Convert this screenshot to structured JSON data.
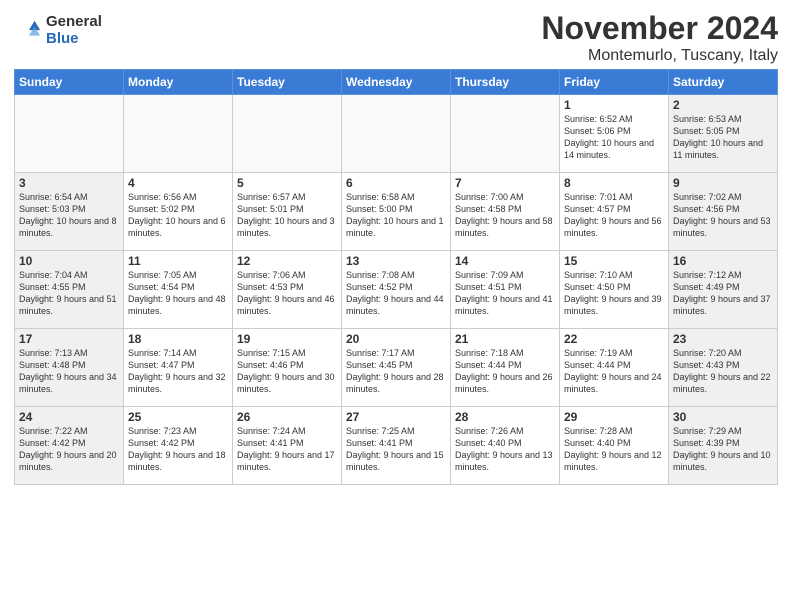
{
  "header": {
    "logo_general": "General",
    "logo_blue": "Blue",
    "month_title": "November 2024",
    "location": "Montemurlo, Tuscany, Italy"
  },
  "columns": [
    "Sunday",
    "Monday",
    "Tuesday",
    "Wednesday",
    "Thursday",
    "Friday",
    "Saturday"
  ],
  "weeks": [
    [
      {
        "day": "",
        "type": "empty",
        "info": ""
      },
      {
        "day": "",
        "type": "empty",
        "info": ""
      },
      {
        "day": "",
        "type": "empty",
        "info": ""
      },
      {
        "day": "",
        "type": "empty",
        "info": ""
      },
      {
        "day": "",
        "type": "empty",
        "info": ""
      },
      {
        "day": "1",
        "type": "weekend",
        "info": "Sunrise: 6:52 AM\nSunset: 5:06 PM\nDaylight: 10 hours and 14 minutes."
      },
      {
        "day": "2",
        "type": "weekend",
        "info": "Sunrise: 6:53 AM\nSunset: 5:05 PM\nDaylight: 10 hours and 11 minutes."
      }
    ],
    [
      {
        "day": "3",
        "type": "weekend",
        "info": "Sunrise: 6:54 AM\nSunset: 5:03 PM\nDaylight: 10 hours and 8 minutes."
      },
      {
        "day": "4",
        "type": "weekday",
        "info": "Sunrise: 6:56 AM\nSunset: 5:02 PM\nDaylight: 10 hours and 6 minutes."
      },
      {
        "day": "5",
        "type": "weekday",
        "info": "Sunrise: 6:57 AM\nSunset: 5:01 PM\nDaylight: 10 hours and 3 minutes."
      },
      {
        "day": "6",
        "type": "weekday",
        "info": "Sunrise: 6:58 AM\nSunset: 5:00 PM\nDaylight: 10 hours and 1 minute."
      },
      {
        "day": "7",
        "type": "weekday",
        "info": "Sunrise: 7:00 AM\nSunset: 4:58 PM\nDaylight: 9 hours and 58 minutes."
      },
      {
        "day": "8",
        "type": "weekend",
        "info": "Sunrise: 7:01 AM\nSunset: 4:57 PM\nDaylight: 9 hours and 56 minutes."
      },
      {
        "day": "9",
        "type": "weekend",
        "info": "Sunrise: 7:02 AM\nSunset: 4:56 PM\nDaylight: 9 hours and 53 minutes."
      }
    ],
    [
      {
        "day": "10",
        "type": "weekend",
        "info": "Sunrise: 7:04 AM\nSunset: 4:55 PM\nDaylight: 9 hours and 51 minutes."
      },
      {
        "day": "11",
        "type": "weekday",
        "info": "Sunrise: 7:05 AM\nSunset: 4:54 PM\nDaylight: 9 hours and 48 minutes."
      },
      {
        "day": "12",
        "type": "weekday",
        "info": "Sunrise: 7:06 AM\nSunset: 4:53 PM\nDaylight: 9 hours and 46 minutes."
      },
      {
        "day": "13",
        "type": "weekday",
        "info": "Sunrise: 7:08 AM\nSunset: 4:52 PM\nDaylight: 9 hours and 44 minutes."
      },
      {
        "day": "14",
        "type": "weekday",
        "info": "Sunrise: 7:09 AM\nSunset: 4:51 PM\nDaylight: 9 hours and 41 minutes."
      },
      {
        "day": "15",
        "type": "weekend",
        "info": "Sunrise: 7:10 AM\nSunset: 4:50 PM\nDaylight: 9 hours and 39 minutes."
      },
      {
        "day": "16",
        "type": "weekend",
        "info": "Sunrise: 7:12 AM\nSunset: 4:49 PM\nDaylight: 9 hours and 37 minutes."
      }
    ],
    [
      {
        "day": "17",
        "type": "weekend",
        "info": "Sunrise: 7:13 AM\nSunset: 4:48 PM\nDaylight: 9 hours and 34 minutes."
      },
      {
        "day": "18",
        "type": "weekday",
        "info": "Sunrise: 7:14 AM\nSunset: 4:47 PM\nDaylight: 9 hours and 32 minutes."
      },
      {
        "day": "19",
        "type": "weekday",
        "info": "Sunrise: 7:15 AM\nSunset: 4:46 PM\nDaylight: 9 hours and 30 minutes."
      },
      {
        "day": "20",
        "type": "weekday",
        "info": "Sunrise: 7:17 AM\nSunset: 4:45 PM\nDaylight: 9 hours and 28 minutes."
      },
      {
        "day": "21",
        "type": "weekday",
        "info": "Sunrise: 7:18 AM\nSunset: 4:44 PM\nDaylight: 9 hours and 26 minutes."
      },
      {
        "day": "22",
        "type": "weekend",
        "info": "Sunrise: 7:19 AM\nSunset: 4:44 PM\nDaylight: 9 hours and 24 minutes."
      },
      {
        "day": "23",
        "type": "weekend",
        "info": "Sunrise: 7:20 AM\nSunset: 4:43 PM\nDaylight: 9 hours and 22 minutes."
      }
    ],
    [
      {
        "day": "24",
        "type": "weekend",
        "info": "Sunrise: 7:22 AM\nSunset: 4:42 PM\nDaylight: 9 hours and 20 minutes."
      },
      {
        "day": "25",
        "type": "weekday",
        "info": "Sunrise: 7:23 AM\nSunset: 4:42 PM\nDaylight: 9 hours and 18 minutes."
      },
      {
        "day": "26",
        "type": "weekday",
        "info": "Sunrise: 7:24 AM\nSunset: 4:41 PM\nDaylight: 9 hours and 17 minutes."
      },
      {
        "day": "27",
        "type": "weekday",
        "info": "Sunrise: 7:25 AM\nSunset: 4:41 PM\nDaylight: 9 hours and 15 minutes."
      },
      {
        "day": "28",
        "type": "weekday",
        "info": "Sunrise: 7:26 AM\nSunset: 4:40 PM\nDaylight: 9 hours and 13 minutes."
      },
      {
        "day": "29",
        "type": "weekend",
        "info": "Sunrise: 7:28 AM\nSunset: 4:40 PM\nDaylight: 9 hours and 12 minutes."
      },
      {
        "day": "30",
        "type": "weekend",
        "info": "Sunrise: 7:29 AM\nSunset: 4:39 PM\nDaylight: 9 hours and 10 minutes."
      }
    ]
  ]
}
